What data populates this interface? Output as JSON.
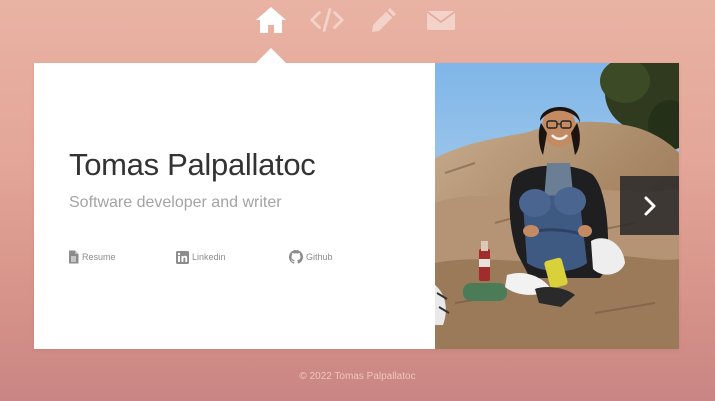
{
  "nav": {
    "items": [
      {
        "icon": "home-icon",
        "active": true
      },
      {
        "icon": "code-icon",
        "active": false
      },
      {
        "icon": "pencil-icon",
        "active": false
      },
      {
        "icon": "mail-icon",
        "active": false
      }
    ]
  },
  "profile": {
    "name": "Tomas Palpallatoc",
    "tagline": "Software developer and writer"
  },
  "links": {
    "resume": {
      "label": "Resume",
      "icon": "document-icon"
    },
    "linkedin": {
      "label": "Linkedin",
      "icon": "linkedin-icon"
    },
    "github": {
      "label": "Github",
      "icon": "github-icon"
    }
  },
  "carousel": {
    "next_icon": "chevron-right-icon"
  },
  "footer": {
    "copyright": "© 2022 Tomas Palpallatoc"
  },
  "colors": {
    "background_top": "#e9b3a4",
    "background_bottom": "#c98583",
    "card": "#ffffff",
    "name_text": "#333333",
    "tagline_text": "#a3a3a3",
    "link_text": "#8c8c8c",
    "nav_active": "#ffffff",
    "nav_inactive": "#f3d2c9"
  }
}
